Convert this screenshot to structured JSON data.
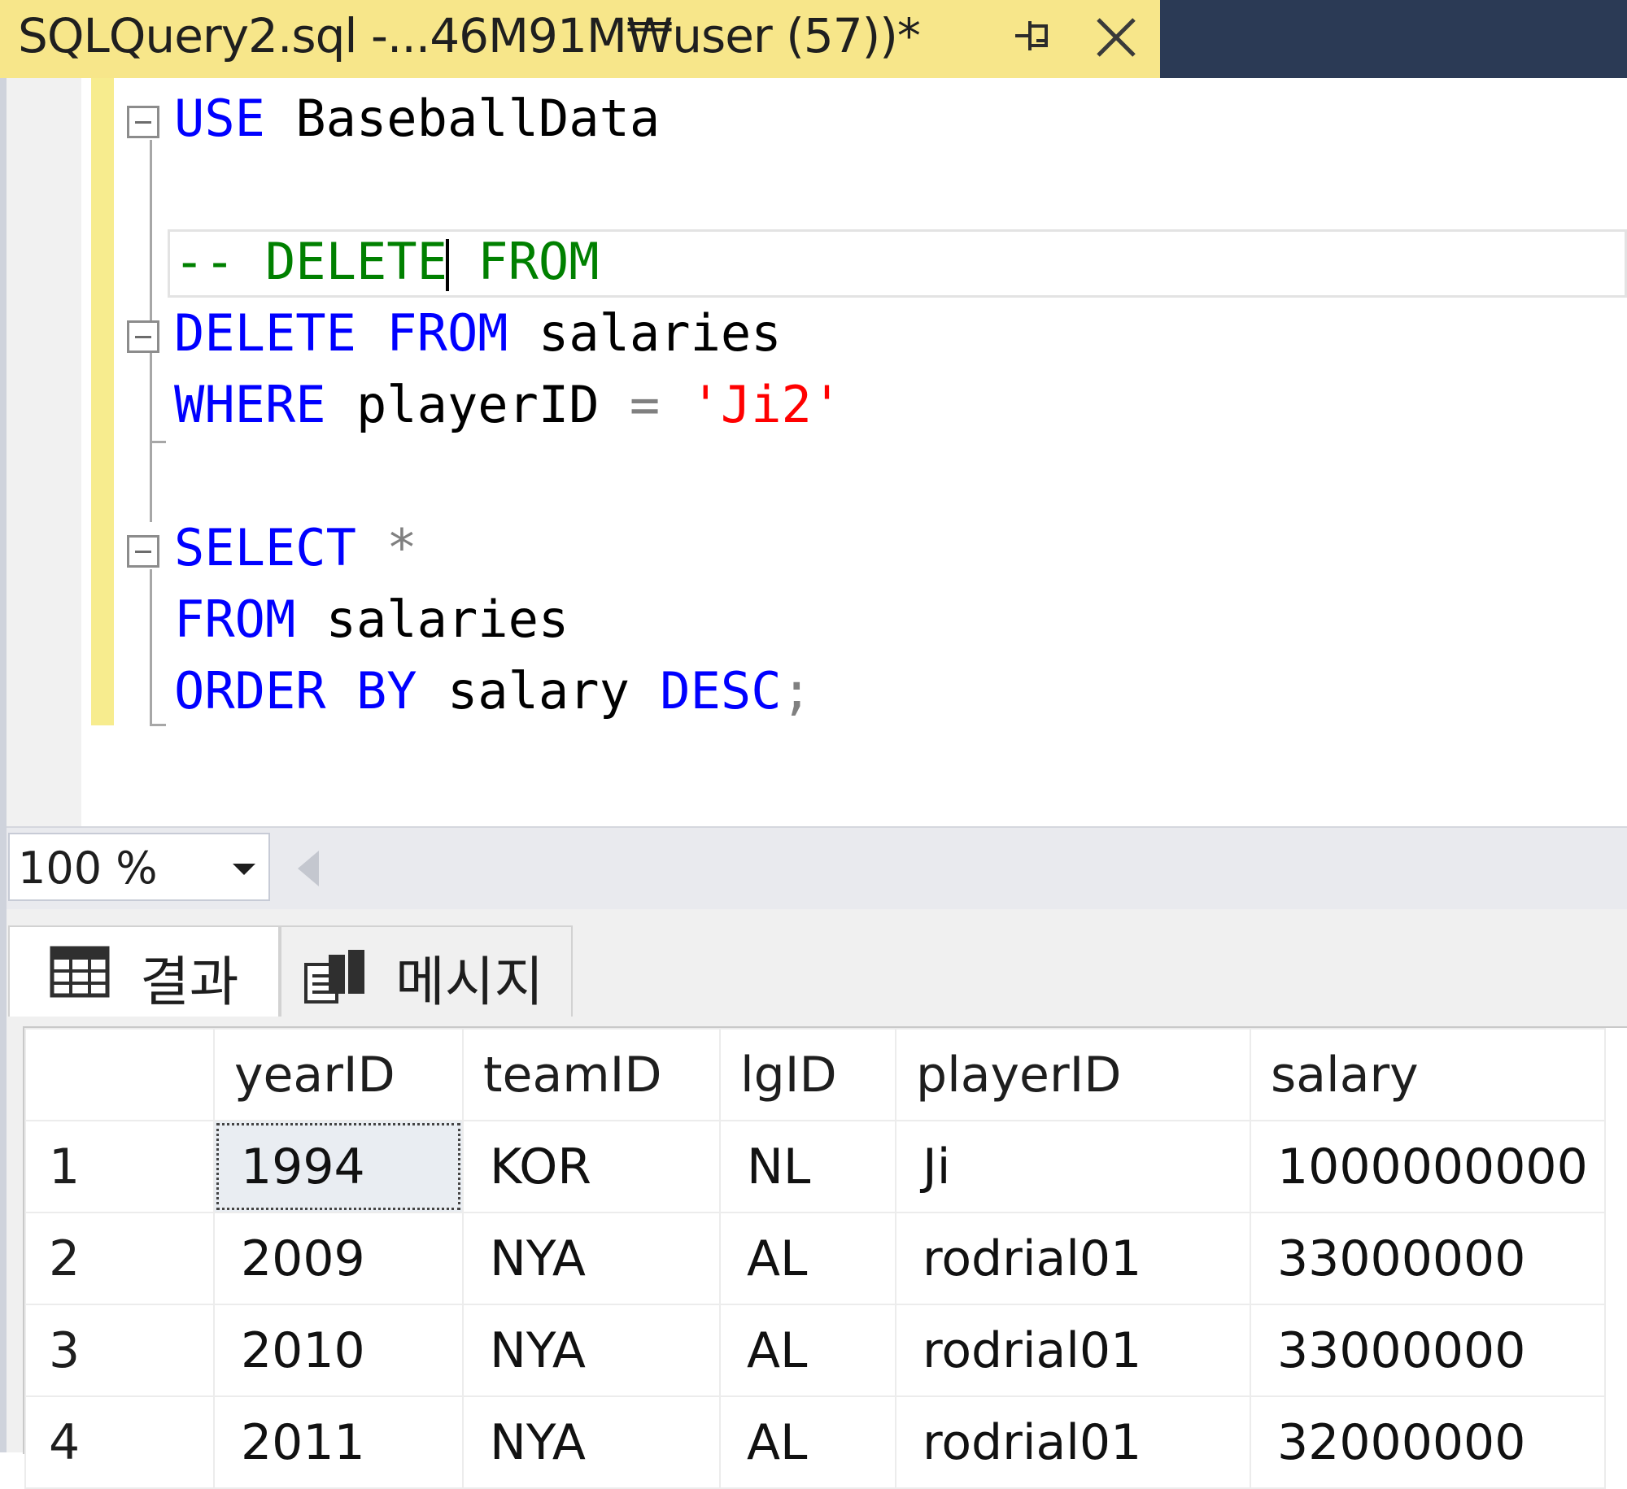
{
  "window": {
    "tab_title": "SQLQuery2.sql -...46M91M₩user (57))*",
    "pin_icon": "pin-icon",
    "close_icon": "close-icon",
    "colors": {
      "tab_bg": "#f7e68a",
      "tabbar_bg": "#2b3a55"
    }
  },
  "editor": {
    "lines": [
      {
        "tokens": [
          {
            "t": "USE",
            "c": "kw"
          },
          {
            "t": " BaseballData",
            "c": "id"
          }
        ]
      },
      {
        "tokens": []
      },
      {
        "tokens": [
          {
            "t": "-- DELETE",
            "c": "cm"
          },
          {
            "t": "",
            "c": "caret"
          },
          {
            "t": " FROM",
            "c": "cm"
          }
        ]
      },
      {
        "tokens": [
          {
            "t": "DELETE",
            "c": "kw"
          },
          {
            "t": " ",
            "c": "id"
          },
          {
            "t": "FROM",
            "c": "kw"
          },
          {
            "t": " salaries",
            "c": "id"
          }
        ]
      },
      {
        "tokens": [
          {
            "t": "WHERE",
            "c": "kw"
          },
          {
            "t": " playerID ",
            "c": "id"
          },
          {
            "t": "=",
            "c": "op"
          },
          {
            "t": " ",
            "c": "id"
          },
          {
            "t": "'Ji2'",
            "c": "str"
          }
        ]
      },
      {
        "tokens": []
      },
      {
        "tokens": [
          {
            "t": "SELECT",
            "c": "kw"
          },
          {
            "t": " ",
            "c": "id"
          },
          {
            "t": "*",
            "c": "op"
          }
        ]
      },
      {
        "tokens": [
          {
            "t": "FROM",
            "c": "kw"
          },
          {
            "t": " salaries",
            "c": "id"
          }
        ]
      },
      {
        "tokens": [
          {
            "t": "ORDER",
            "c": "kw"
          },
          {
            "t": " ",
            "c": "id"
          },
          {
            "t": "BY",
            "c": "kw"
          },
          {
            "t": " salary ",
            "c": "id"
          },
          {
            "t": "DESC",
            "c": "kw"
          },
          {
            "t": ";",
            "c": "op"
          }
        ]
      }
    ]
  },
  "zoom": {
    "value": "100 %"
  },
  "results": {
    "tabs": [
      {
        "label": "결과",
        "icon": "grid-icon"
      },
      {
        "label": "메시지",
        "icon": "messages-icon"
      }
    ],
    "columns": [
      "yearID",
      "teamID",
      "lgID",
      "playerID",
      "salary"
    ],
    "rows": [
      {
        "num": "1",
        "cells": [
          "1994",
          "KOR",
          "NL",
          "Ji",
          "1000000000"
        ]
      },
      {
        "num": "2",
        "cells": [
          "2009",
          "NYA",
          "AL",
          "rodrial01",
          "33000000"
        ]
      },
      {
        "num": "3",
        "cells": [
          "2010",
          "NYA",
          "AL",
          "rodrial01",
          "33000000"
        ]
      },
      {
        "num": "4",
        "cells": [
          "2011",
          "NYA",
          "AL",
          "rodrial01",
          "32000000"
        ]
      }
    ]
  }
}
